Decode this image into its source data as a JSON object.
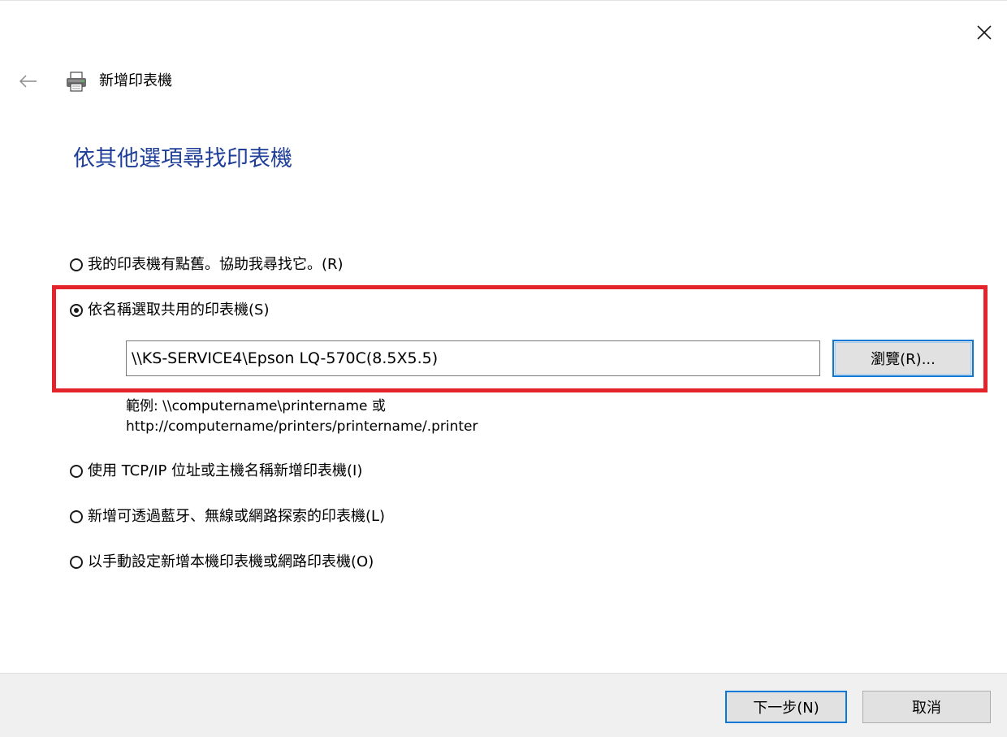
{
  "window": {
    "title": "新增印表機",
    "close_icon": "close-icon",
    "back_icon": "back-arrow-icon",
    "app_icon": "printer-icon"
  },
  "page": {
    "heading": "依其他選項尋找印表機",
    "heading_color": "#1f3f9a"
  },
  "options": [
    {
      "label": "我的印表機有點舊。協助我尋找它。(R)",
      "selected": false
    },
    {
      "label": "依名稱選取共用的印表機(S)",
      "selected": true
    },
    {
      "label": "使用 TCP/IP 位址或主機名稱新增印表機(I)",
      "selected": false
    },
    {
      "label": "新增可透過藍牙、無線或網路探索的印表機(L)",
      "selected": false
    },
    {
      "label": "以手動設定新增本機印表機或網路印表機(O)",
      "selected": false
    }
  ],
  "shared_printer": {
    "value": "\\\\KS-SERVICE4\\Epson LQ-570C(8.5X5.5)",
    "browse_label": "瀏覽(R)...",
    "example_line1": "範例: \\\\computername\\printername 或",
    "example_line2": "http://computername/printers/printername/.printer"
  },
  "highlight": {
    "color": "#e3242b"
  },
  "footer": {
    "next_label": "下一步(N)",
    "cancel_label": "取消"
  },
  "accent_color": "#0a78d7"
}
